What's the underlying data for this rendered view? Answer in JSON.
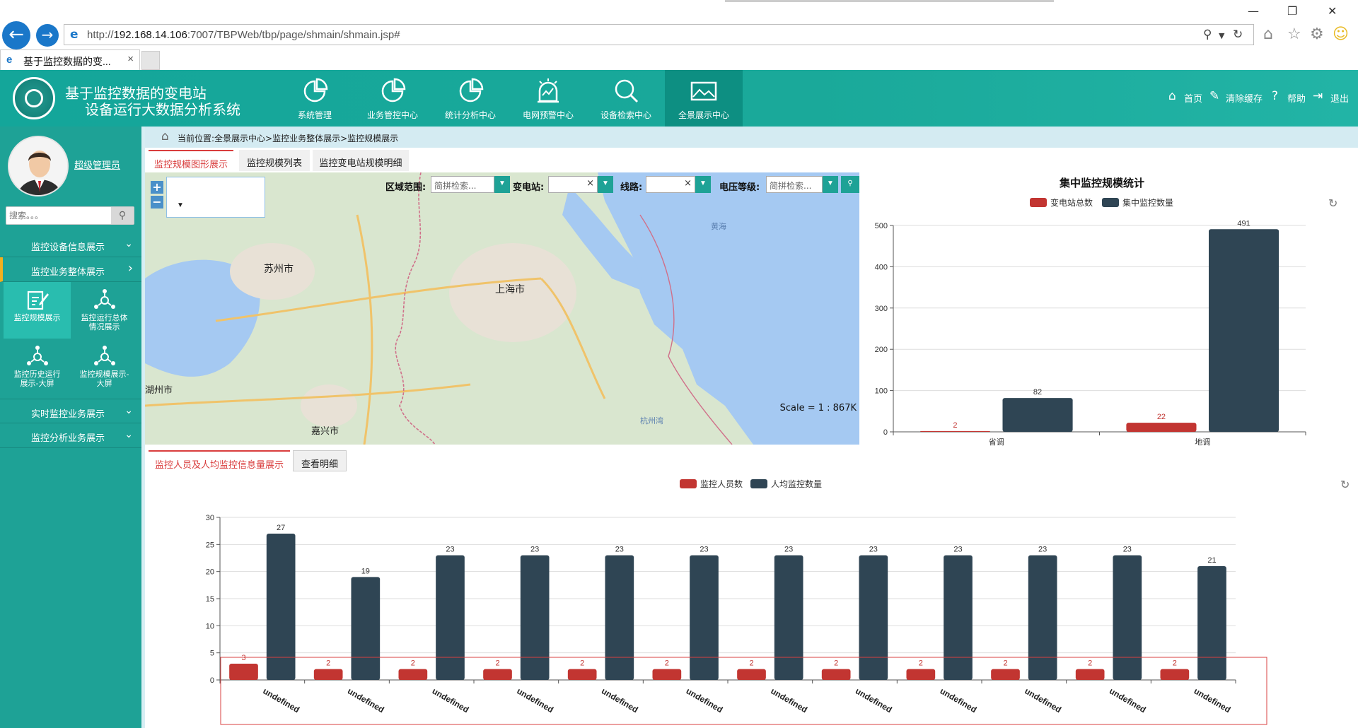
{
  "browser": {
    "url_prefix": "http://",
    "url_host": "192.168.14.106",
    "url_rest": ":7007/TBPWeb/tbp/page/shmain/shmain.jsp#",
    "tab_title": "基于监控数据的变...",
    "tab_close": "×"
  },
  "header": {
    "title_line1": "基于监控数据的变电站",
    "title_line2": "设备运行大数据分析系统",
    "modules": [
      {
        "label": "系统管理",
        "icon": "pie-chart-icon"
      },
      {
        "label": "业务管控中心",
        "icon": "pie-chart-icon"
      },
      {
        "label": "统计分析中心",
        "icon": "pie-chart-icon"
      },
      {
        "label": "电网预警中心",
        "icon": "alarm-icon"
      },
      {
        "label": "设备检索中心",
        "icon": "search-icon"
      },
      {
        "label": "全景展示中心",
        "icon": "panorama-icon"
      }
    ],
    "links": {
      "home": "首页",
      "clear_cache": "清除缓存",
      "help": "帮助",
      "logout": "退出"
    }
  },
  "sidebar": {
    "user_name": "超级管理员",
    "search_placeholder": "搜索。。。",
    "menus": [
      {
        "label": "监控设备信息展示",
        "chevron": "⌄"
      },
      {
        "label": "监控业务整体展示",
        "chevron": "›"
      },
      {
        "label": "实时监控业务展示",
        "chevron": "⌄"
      },
      {
        "label": "监控分析业务展示",
        "chevron": "⌄"
      }
    ],
    "sub_items": [
      {
        "label": "监控规模展示"
      },
      {
        "label": "监控运行总体情况展示"
      },
      {
        "label": "监控历史运行展示-大屏"
      },
      {
        "label": "监控规模展示-大屏"
      }
    ]
  },
  "breadcrumb": {
    "text": "当前位置:全景展示中心>监控业务整体展示>监控规模展示"
  },
  "top_tabs": [
    "监控规模图形展示",
    "监控规模列表",
    "监控变电站规模明细"
  ],
  "map": {
    "filters": {
      "area_label": "区域范围:",
      "area_placeholder": "简拼检索...",
      "station_label": "变电站:",
      "line_label": "线路:",
      "voltage_label": "电压等级:",
      "voltage_placeholder": "简拼检索..."
    },
    "scale": "Scale = 1 : 867K",
    "places": [
      "苏州市",
      "上海市",
      "嘉兴市",
      "湖州市",
      "黄海",
      "杭州湾"
    ]
  },
  "bottom_tabs": [
    "监控人员及人均监控信息量展示",
    "查看明细"
  ],
  "colors": {
    "red": "#c23531",
    "navy": "#2f4554",
    "teal": "#1ea296",
    "accent_red": "#d93d3d"
  },
  "chart_data": [
    {
      "type": "bar",
      "title": "集中监控规模统计",
      "categories": [
        "省调",
        "地调"
      ],
      "series": [
        {
          "name": "变电站总数",
          "values": [
            2,
            22
          ],
          "color": "#c23531"
        },
        {
          "name": "集中监控数量",
          "values": [
            82,
            491
          ],
          "color": "#2f4554"
        }
      ],
      "ylim": [
        0,
        500
      ],
      "yticks": [
        0,
        100,
        200,
        300,
        400,
        500
      ],
      "legend": "top-center",
      "grid": true
    },
    {
      "type": "bar",
      "title": "",
      "categories": [
        "undefined",
        "undefined",
        "undefined",
        "undefined",
        "undefined",
        "undefined",
        "undefined",
        "undefined",
        "undefined",
        "undefined",
        "undefined",
        "undefined"
      ],
      "series": [
        {
          "name": "监控人员数",
          "values": [
            3,
            2,
            2,
            2,
            2,
            2,
            2,
            2,
            2,
            2,
            2,
            2
          ],
          "color": "#c23531"
        },
        {
          "name": "人均监控数量",
          "values": [
            27,
            19,
            23,
            23,
            23,
            23,
            23,
            23,
            23,
            23,
            23,
            21
          ],
          "color": "#2f4554"
        }
      ],
      "ylim": [
        0,
        30
      ],
      "yticks": [
        0,
        5,
        10,
        15,
        20,
        25,
        30
      ],
      "legend": "top-center",
      "grid": true
    }
  ]
}
